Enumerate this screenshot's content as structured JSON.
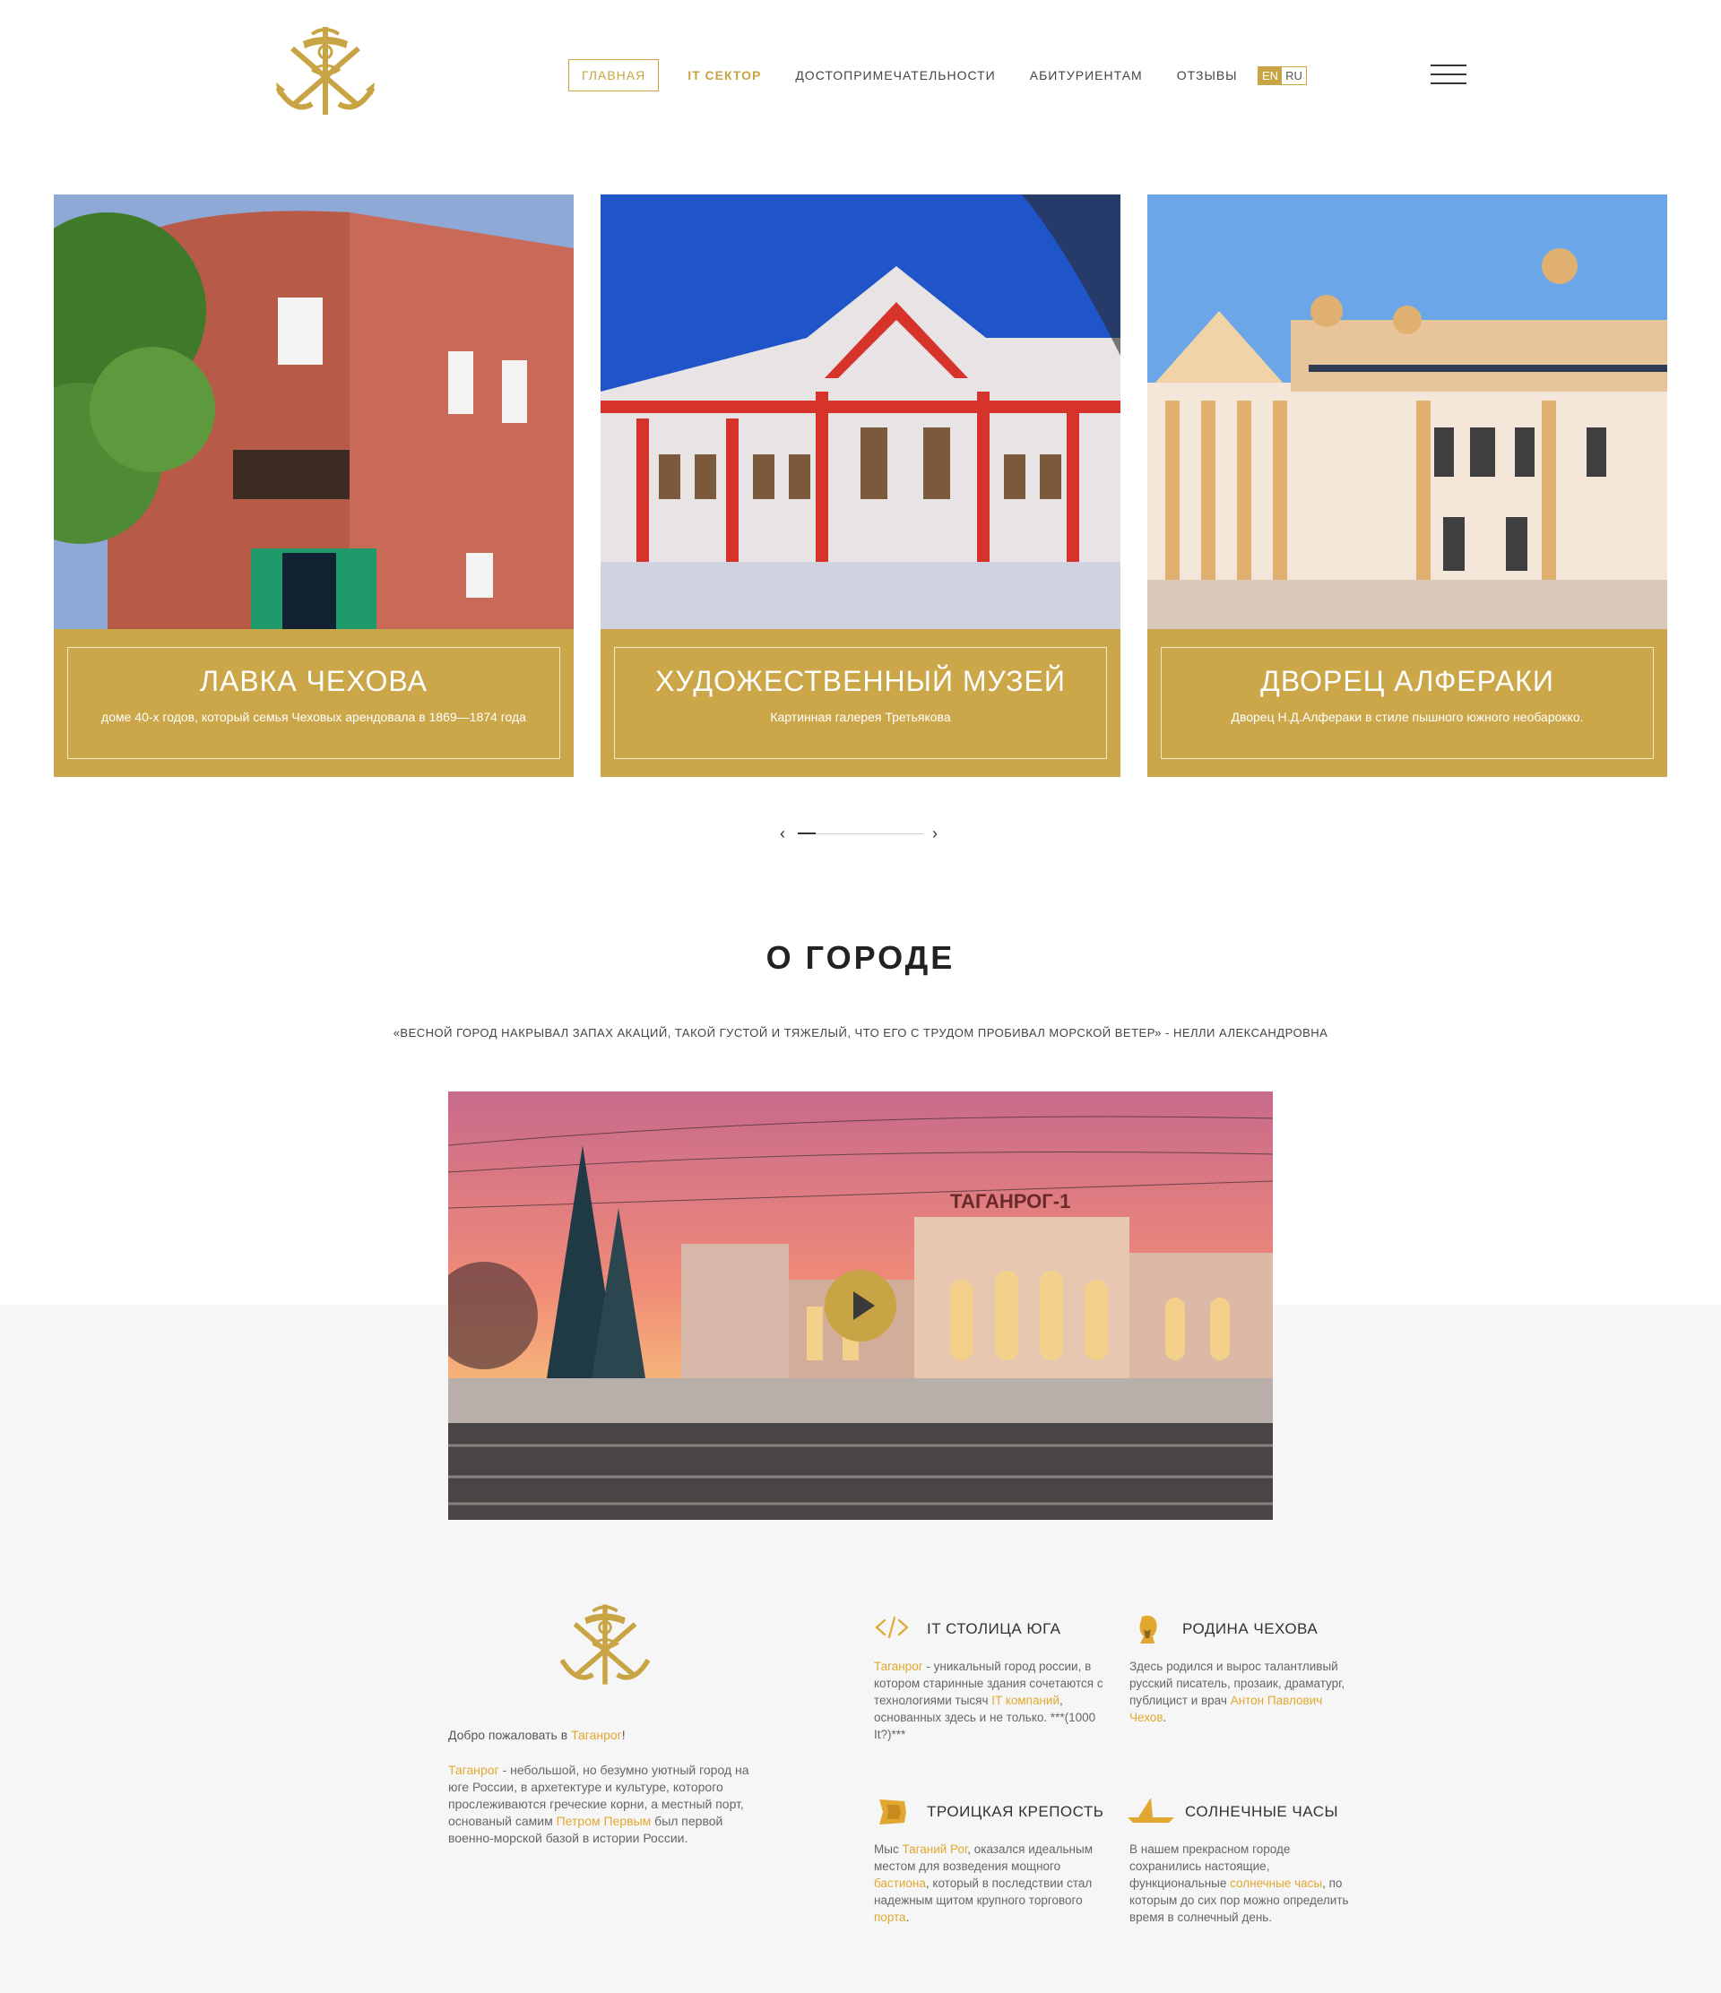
{
  "header": {
    "nav": [
      {
        "label": "ГЛАВНАЯ"
      },
      {
        "label": "IT СЕКТОР"
      },
      {
        "label": "ДОСТОПРИМЕЧАТЕЛЬНОСТИ"
      },
      {
        "label": "АБИТУРИЕНТАМ"
      },
      {
        "label": "ОТЗЫВЫ"
      }
    ],
    "lang": {
      "en": "EN",
      "ru": "RU"
    }
  },
  "slides": [
    {
      "title": "ЛАВКА ЧЕХОВА",
      "subtitle": "доме 40-х годов, который семья Чеховых арендовала в 1869—1874 года"
    },
    {
      "title": "ХУДОЖЕСТВЕННЫЙ МУЗЕЙ",
      "subtitle": "Картинная галерея Третьякова"
    },
    {
      "title": "ДВОРЕЦ АЛФЕРАКИ",
      "subtitle": "Дворец Н.Д.Алфераки в стиле пышного южного необарокко."
    }
  ],
  "slider": {
    "prev": "‹",
    "next": "›"
  },
  "about_city": {
    "title": "О ГОРОДЕ",
    "quote": "«ВЕСНОЙ ГОРОД НАКРЫВАЛ ЗАПАХ АКАЦИЙ, ТАКОЙ ГУСТОЙ И ТЯЖЕЛЫЙ, ЧТО ЕГО С ТРУДОМ ПРОБИВАЛ МОРСКОЙ ВЕТЕР» - НЕЛЛИ АЛЕКСАНДРОВНА",
    "video_sign": "ТАГАНРОГ-1"
  },
  "welcome": {
    "prefix": "Добро пожаловать в ",
    "city": "Таганрог",
    "suffix": "!",
    "p_city": "Таганрог",
    "p1": " - небольшой, но безумно уютный город на юге России, в архетектуре и культуре, которого прослеживаются греческие корни, а местный порт, основаный самим ",
    "p_link": "Петром Первым",
    "p2": " был первой военно-морской базой в истории России."
  },
  "features": [
    {
      "title": "IT СТОЛИЦА ЮГА",
      "icon": "code-icon",
      "t1": "Таганрог",
      "t2": " - уникальный город россии, в котором старинные здания сочетаются с технологиями тысяч ",
      "t3": "IT компаний",
      "t4": ", основанных здесь и не только.     ***(1000 It?)***"
    },
    {
      "title": "РОДИНА ЧЕХОВА",
      "icon": "chekhov-portrait-icon",
      "t1": "Здесь родился и вырос талантливый русский писатель, прозаик, драматург, публицист и врач ",
      "t2": "Антон Павлович Чехов",
      "t3": "."
    },
    {
      "title": "ТРОИЦКАЯ КРЕПОСТЬ",
      "icon": "fortress-icon",
      "t1": "Мыс ",
      "t2": "Таганий Рог",
      "t3": ", оказался идеальным местом для возведения мощного ",
      "t4": "бастиона",
      "t5": ", который в последствии стал надежным щитом крупного торгового ",
      "t6": "порта",
      "t7": "."
    },
    {
      "title": "СОЛНЕЧНЫЕ ЧАСЫ",
      "icon": "sundial-icon",
      "t1": "В нашем прекрасном городе сохранились настоящие, функциональные ",
      "t2": "солнечные часы",
      "t3": ", по которым до сих пор можно определить время в солнечный день."
    }
  ],
  "colors": {
    "accent": "#c9a444",
    "link": "#e0a830",
    "footer_bg": "#f7f6f6"
  }
}
